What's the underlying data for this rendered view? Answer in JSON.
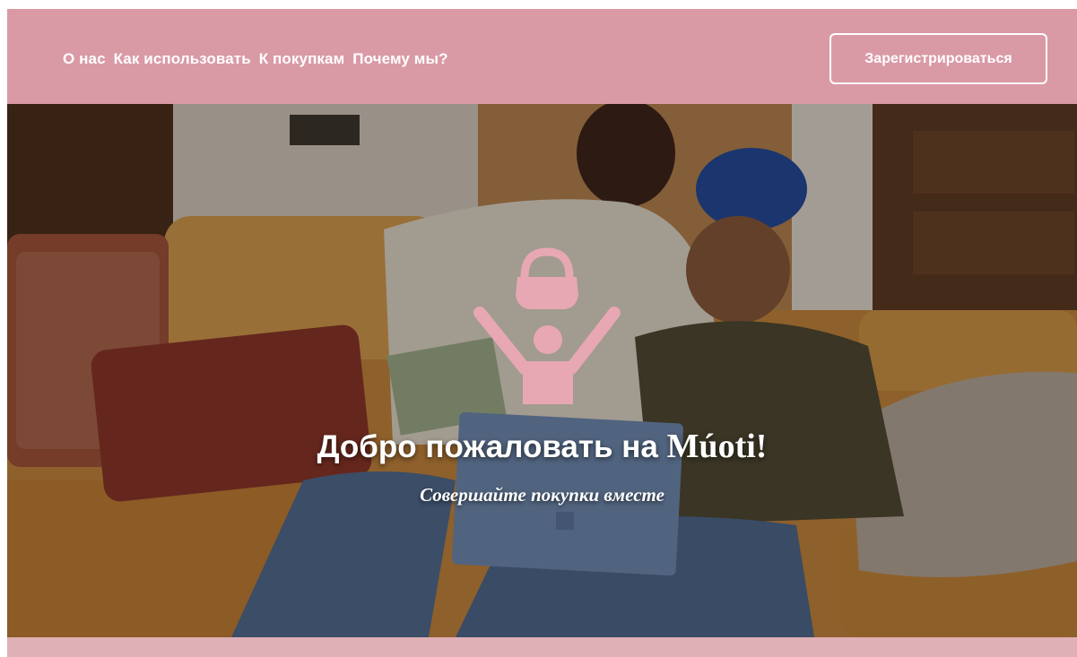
{
  "nav": {
    "links": [
      "О нас",
      "Как использовать",
      "К покупкам",
      "Почему мы?"
    ],
    "register_label": "Зарегистрироваться"
  },
  "hero": {
    "title_prefix": "Добро пожаловать на ",
    "title_brand": "Múoti!",
    "subtitle": "Совершайте покупки вместе",
    "logo_icon": "shopping-bag-person-icon"
  },
  "colors": {
    "brand_pink": "#d99aa6",
    "logo_pink": "#e7a8b3",
    "bottom_strip": "#dfb0b5"
  }
}
